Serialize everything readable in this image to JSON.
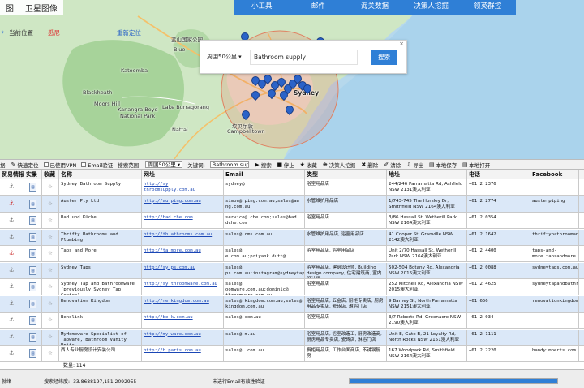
{
  "map": {
    "tabs": [
      "图",
      "卫星图像"
    ],
    "location": {
      "label": "当前位置",
      "city": "悉尼",
      "reset": "重新定位"
    },
    "nav": [
      "小工具",
      "邮件",
      "海关数据",
      "决策人挖掘",
      "领英群控"
    ],
    "places": [
      {
        "name": "蓝山国家公园",
        "kind": "normal"
      },
      {
        "name": "Blue",
        "kind": "normal"
      },
      {
        "name": "Katoomba",
        "kind": "normal"
      },
      {
        "name": "Kanangra-Boyd",
        "kind": "normal"
      },
      {
        "name": "National Park",
        "kind": "normal"
      },
      {
        "name": "Lake Burragorang",
        "kind": "normal"
      },
      {
        "name": "Blackheath",
        "kind": "normal"
      },
      {
        "name": "Moors Hill",
        "kind": "normal"
      },
      {
        "name": "Nattai",
        "kind": "normal"
      },
      {
        "name": "Sydney",
        "kind": "city"
      },
      {
        "name": "坎贝尔敦",
        "kind": "normal"
      },
      {
        "name": "Campbelltown",
        "kind": "normal"
      }
    ],
    "search": {
      "close": "×",
      "range": "周围50公里 ▾",
      "keyword": "Bathroom supply",
      "button": "搜索"
    }
  },
  "toolbar": {
    "items": [
      {
        "icon": "",
        "label": "据"
      },
      {
        "icon": "✎",
        "label": "快速定位"
      },
      {
        "icon": "☐",
        "label": "已使用VPN",
        "check": true
      },
      {
        "icon": "☐",
        "label": "Email验证",
        "check": true
      },
      {
        "icon": "",
        "label": "搜索范围:"
      },
      {
        "icon": "",
        "label": "周围50公里 ▾",
        "select": true
      },
      {
        "icon": "",
        "label": "关键词:"
      },
      {
        "icon": "",
        "label": "Bathroom supply",
        "input": true
      },
      {
        "icon": "▶",
        "label": "搜索"
      },
      {
        "icon": "■",
        "label": "停止"
      },
      {
        "icon": "★",
        "label": "收藏"
      },
      {
        "icon": "♚",
        "label": "决策人挖掘"
      },
      {
        "icon": "✖",
        "label": "删除"
      },
      {
        "icon": "✐",
        "label": "清除"
      },
      {
        "icon": "⇩",
        "label": "导出"
      },
      {
        "icon": "▤",
        "label": "本地保存"
      },
      {
        "icon": "▤",
        "label": "本地打开"
      }
    ]
  },
  "grid": {
    "columns": [
      "贸易情报",
      "实景",
      "收藏",
      "名称",
      "网址",
      "Email",
      "类型",
      "地址",
      "电话",
      "Facebook"
    ],
    "rows": [
      {
        "name": "Sydney Bathroom Supply",
        "url": "http://sy  throomsupply.com.au",
        "email": "sydney@",
        "type": "浴室用品店",
        "address": "244/246 Parramatta Rd, Ashfield NSW 2131澳大利亚",
        "phone": "+61 2  2376",
        "fb": "",
        "red": false
      },
      {
        "name": "Auster Pty Ltd",
        "url": "http://au  ping.com.au",
        "email": "simon@  ping.com.au;sales@au  ng.com.au",
        "type": "水管维护用品店",
        "address": "1/743-745 The Horsley Dr, Smithfield NSW 2164澳大利亚",
        "phone": "+61 2  2774",
        "fb": "austerpiping",
        "red": true
      },
      {
        "name": "Bad und Küche",
        "url": "http://bad  che.com",
        "email": "service@  che.com;sales@bad  dche.com",
        "type": "浴室用品店",
        "address": "3/86 Hassall St, Wetherill Park NSW 2164澳大利亚",
        "phone": "+61 2  0354",
        "fb": "",
        "red": false
      },
      {
        "name": "Thrifty Bathrooms and Plumbing",
        "url": "http://th  athrooms.com.au",
        "email": "sales@  oms.com.au",
        "type": "水管维护用品店, 浴室用品店",
        "address": "41 Cooper St, Granville NSW 2142澳大利亚",
        "phone": "+61 2  1642",
        "fb": "thriftybathroomandplumbing",
        "red": false
      },
      {
        "name": "Taps and More",
        "url": "http://ta  more.com.au",
        "email": "sales@  e.com.au;priyank.dutt@",
        "type": "浴室用品店, 浴室用品店",
        "address": "Unit 2/70 Hassall St, Wetherill Park NSW 2164澳大利亚",
        "phone": "+61 2  4400",
        "fb": "taps-and-more.tapsandmore",
        "red": true
      },
      {
        "name": "Sydney Taps",
        "url": "http://sy  ps.com.au",
        "email": "sales@  ps.com.au;instagram@sydneytaps.com.au",
        "type": "浴室用品店, 建筑设计师, Building design company, 住宅建筑商, 室内设计师",
        "address": "502-504 Botany Rd, Alexandria NSW 2015澳大利亚",
        "phone": "+61 2  0088",
        "fb": "sydneytaps.com.au",
        "red": false
      },
      {
        "name": "Sydney Tap and Bathroomware (previously Sydney Tap Centre)",
        "url": "http://sy  throomware.com.au",
        "email": "sales@  oomware.com.au;dominic@  throomware.com.au",
        "type": "浴室用品店",
        "address": "252 Mitchell Rd, Alexandria NSW 2015澳大利亚",
        "phone": "+61 2  4625",
        "fb": "sydneytapandbathroomware",
        "red": false
      },
      {
        "name": "Renovation Kingdom",
        "url": "http://re  kingdom.com.au",
        "email": "sales@  kingdom.com.au;sales@  kingdom.com.au",
        "type": "浴室用品店, 五金店, 厨柜专卖店, 厨房用品专卖店, 瓷砖店, 淋浴门店",
        "address": "9 Barney St, North Parramatta NSW 2151澳大利亚",
        "phone": "+61  656",
        "fb": "renovationkingdomsydney",
        "red": false
      },
      {
        "name": "Benolink",
        "url": "http://be  k.com.au",
        "email": "sales@  com.au",
        "type": "浴室用品店",
        "address": "3/7 Roberts Rd, Greenacre NSW 2190澳大利亚",
        "phone": "+61 2  034",
        "fb": "",
        "red": false
      },
      {
        "name": "MyHomeware-Specialist of Tapware, Bathroom Vanity Units,",
        "url": "http://my  ware.com.au",
        "email": "sales@  m.au",
        "type": "浴室用品店, 浴室改造工, 厨房改造商, 厨房用品专卖店, 瓷砖店, 淋浴门店",
        "address": "Unit E, Gate B, 21 Loyalty Rd, North Rocks NSW 2151澳大利亚",
        "phone": "+61 2  1111",
        "fb": "",
        "red": false
      },
      {
        "name": "西人专业厨房设计安装公司",
        "url": "http://h  parts.com.au",
        "email": "sales@  .com.au",
        "type": "橱柜用品店, 工作台面商店, 不锈钢厨房",
        "address": "167 Woodpark Rd, Smithfield NSW 2164澳大利亚",
        "phone": "+61 2  2220",
        "fb": "handyimperts.com.au",
        "red": false
      }
    ],
    "count": "数量: 114"
  },
  "status": {
    "left": "就绪",
    "coords": "搜索经纬度: -33.8688197,151.2092955",
    "email": "未进行Email有效性验证",
    "progress": 1.0
  }
}
